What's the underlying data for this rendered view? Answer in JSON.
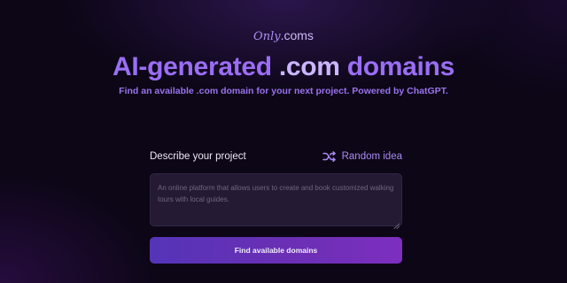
{
  "brand": {
    "logo_script": "Only",
    "logo_suffix": ".coms"
  },
  "hero": {
    "headline_part1": "AI-generated ",
    "headline_accent": ".com",
    "headline_part2": " domains",
    "subtitle": "Find an available .com domain for your next project. Powered by ChatGPT."
  },
  "form": {
    "label": "Describe your project",
    "random_idea": "Random idea",
    "random_icon": "shuffle-icon",
    "textarea_value": "",
    "textarea_placeholder": "An online platform that allows users to create and book customized walking tours with local guides.",
    "submit_label": "Find available domains"
  },
  "colors": {
    "accent": "#9a6ef5",
    "accent_light": "#cab6ff",
    "button_start": "#5534b8",
    "button_end": "#7d2fbf",
    "background": "#0c0616"
  }
}
